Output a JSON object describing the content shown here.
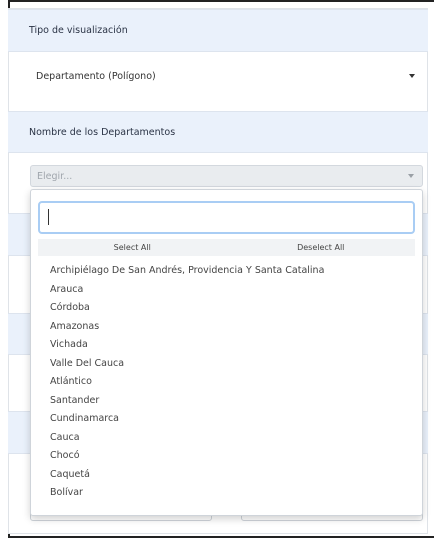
{
  "sections": {
    "tipo": {
      "title": "Tipo de visualización",
      "selected": "Departamento (Polígono)"
    },
    "departamentos": {
      "title": "Nombre de los Departamentos",
      "placeholder": "Elegir..."
    }
  },
  "dropdown": {
    "search_value": "",
    "select_all": "Select All",
    "deselect_all": "Deselect All",
    "options": [
      "Archipiélago De San Andrés, Providencia Y Santa Catalina",
      "Arauca",
      "Córdoba",
      "Amazonas",
      "Vichada",
      "Valle Del Cauca",
      "Atlántico",
      "Santander",
      "Cundinamarca",
      "Cauca",
      "Chocó",
      "Caquetá",
      "Bolívar"
    ]
  },
  "colors": {
    "header_bg": "#eaf1fb",
    "focus_border": "#a9cdf4",
    "disabled_bg": "#e9ecef"
  }
}
